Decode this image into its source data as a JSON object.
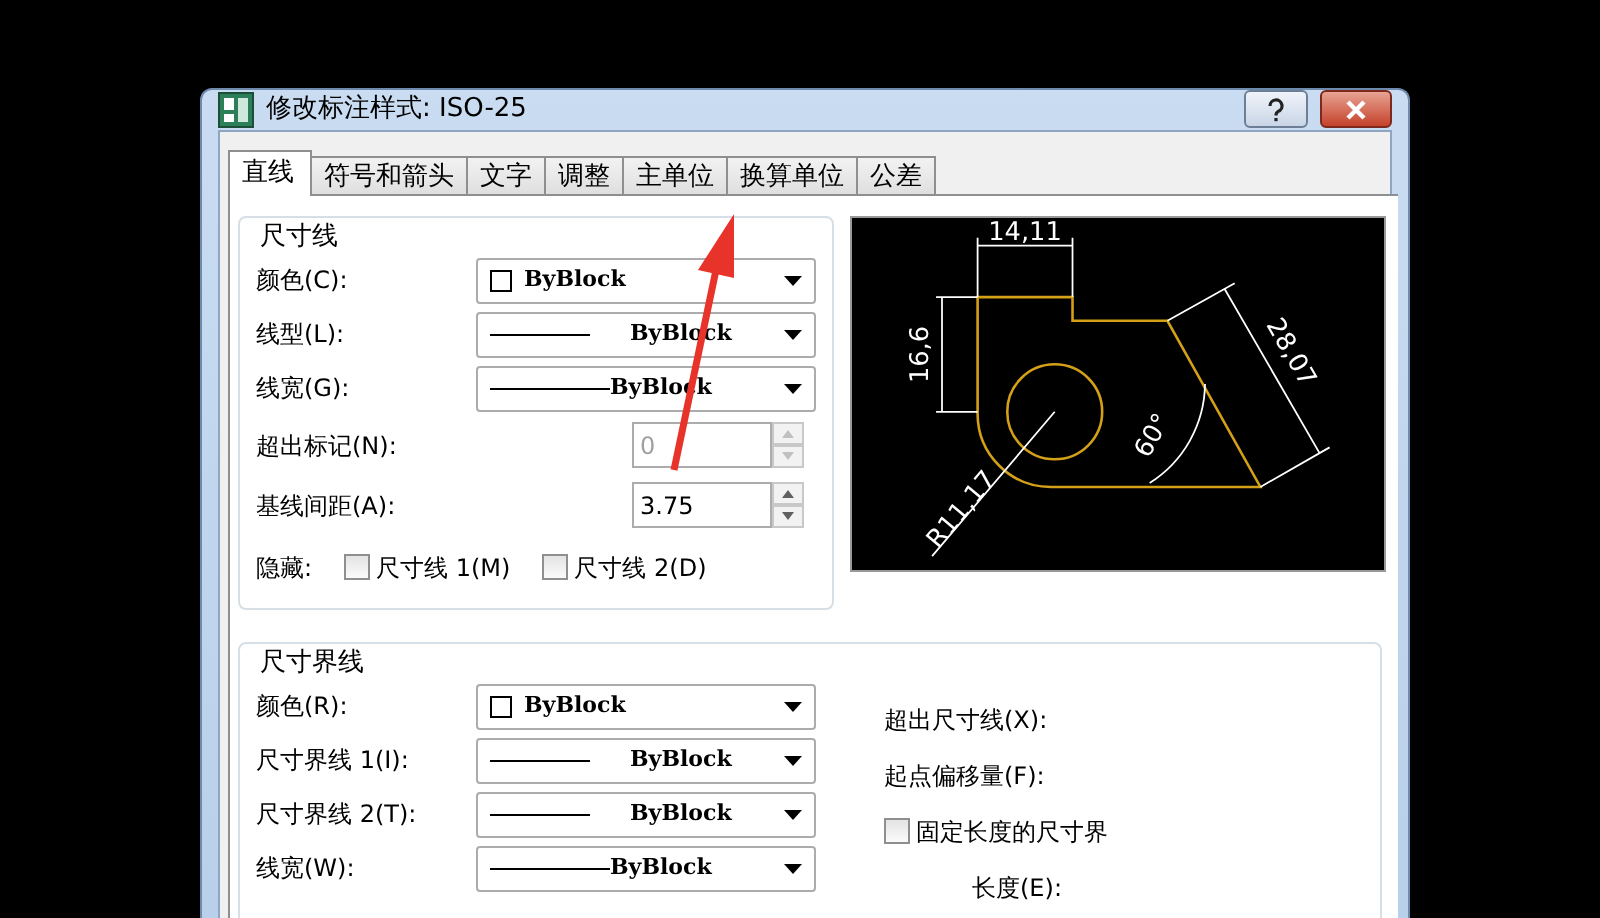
{
  "window": {
    "title": "修改标注样式: ISO-25"
  },
  "tabs": [
    {
      "label": "直线",
      "selected": true
    },
    {
      "label": "符号和箭头",
      "selected": false
    },
    {
      "label": "文字",
      "selected": false
    },
    {
      "label": "调整",
      "selected": false
    },
    {
      "label": "主单位",
      "selected": false
    },
    {
      "label": "换算单位",
      "selected": false
    },
    {
      "label": "公差",
      "selected": false
    }
  ],
  "dimension_lines": {
    "title": "尺寸线",
    "dropdowns": [
      {
        "label": "颜色(C):",
        "value": "ByBlock",
        "kind": "color"
      },
      {
        "label": "线型(L):",
        "value": "ByBlock",
        "kind": "line"
      },
      {
        "label": "线宽(G):",
        "value": "ByBlock",
        "kind": "weight"
      }
    ],
    "spinners": [
      {
        "label": "超出标记(N):",
        "value": "0",
        "disabled": true
      },
      {
        "label": "基线间距(A):",
        "value": "3.75",
        "disabled": false
      }
    ],
    "hide": {
      "label": "隐藏:",
      "options": [
        {
          "label": "尺寸线 1(M)",
          "checked": false
        },
        {
          "label": "尺寸线 2(D)",
          "checked": false
        }
      ]
    }
  },
  "preview": {
    "labels": [
      "14,11",
      "16,6",
      "28,07",
      "60°",
      "R11,17"
    ]
  },
  "extension_lines": {
    "title": "尺寸界线",
    "dropdowns": [
      {
        "label": "颜色(R):",
        "value": "ByBlock",
        "kind": "color"
      },
      {
        "label": "尺寸界线 1(I):",
        "value": "ByBlock",
        "kind": "line"
      },
      {
        "label": "尺寸界线 2(T):",
        "value": "ByBlock",
        "kind": "line"
      },
      {
        "label": "线宽(W):",
        "value": "ByBlock",
        "kind": "weight"
      }
    ],
    "settings": [
      {
        "kind": "label",
        "label": "超出尺寸线(X):"
      },
      {
        "kind": "label",
        "label": "起点偏移量(F):"
      },
      {
        "kind": "checkbox",
        "label": "固定长度的尺寸界",
        "checked": false
      },
      {
        "kind": "indented",
        "label": "长度(E):"
      }
    ]
  }
}
